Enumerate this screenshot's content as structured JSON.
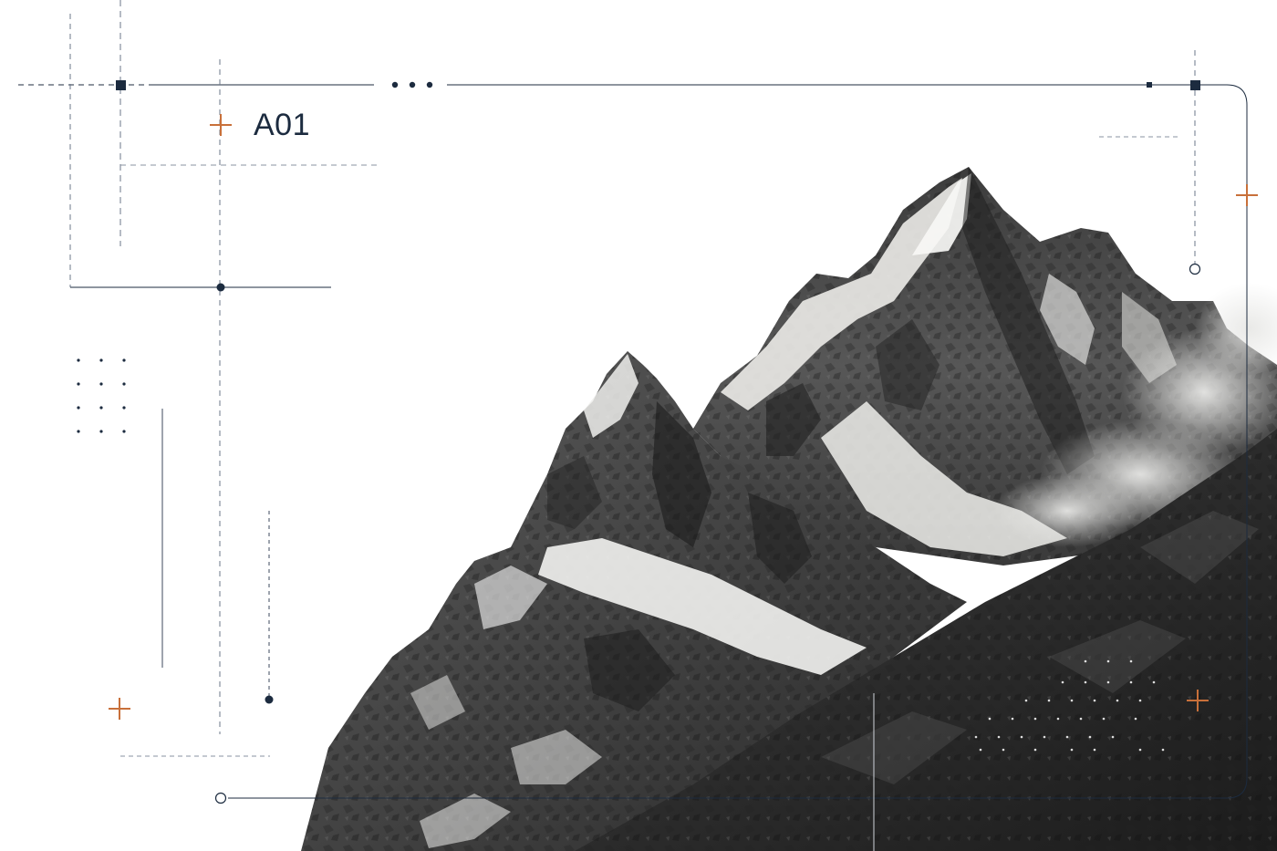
{
  "label": "A01",
  "colors": {
    "ink": "#1c2b3f",
    "accent": "#c8703a",
    "snow": "#f2f2f0",
    "rock_dark": "#2c2c2c",
    "rock_mid": "#6d6d6d",
    "rock_light": "#b8b8b6"
  },
  "icons": {
    "plus": "plus-icon",
    "dots": "ellipsis-icon",
    "node": "node-dot-icon",
    "ring": "ring-icon",
    "square": "square-marker-icon"
  }
}
